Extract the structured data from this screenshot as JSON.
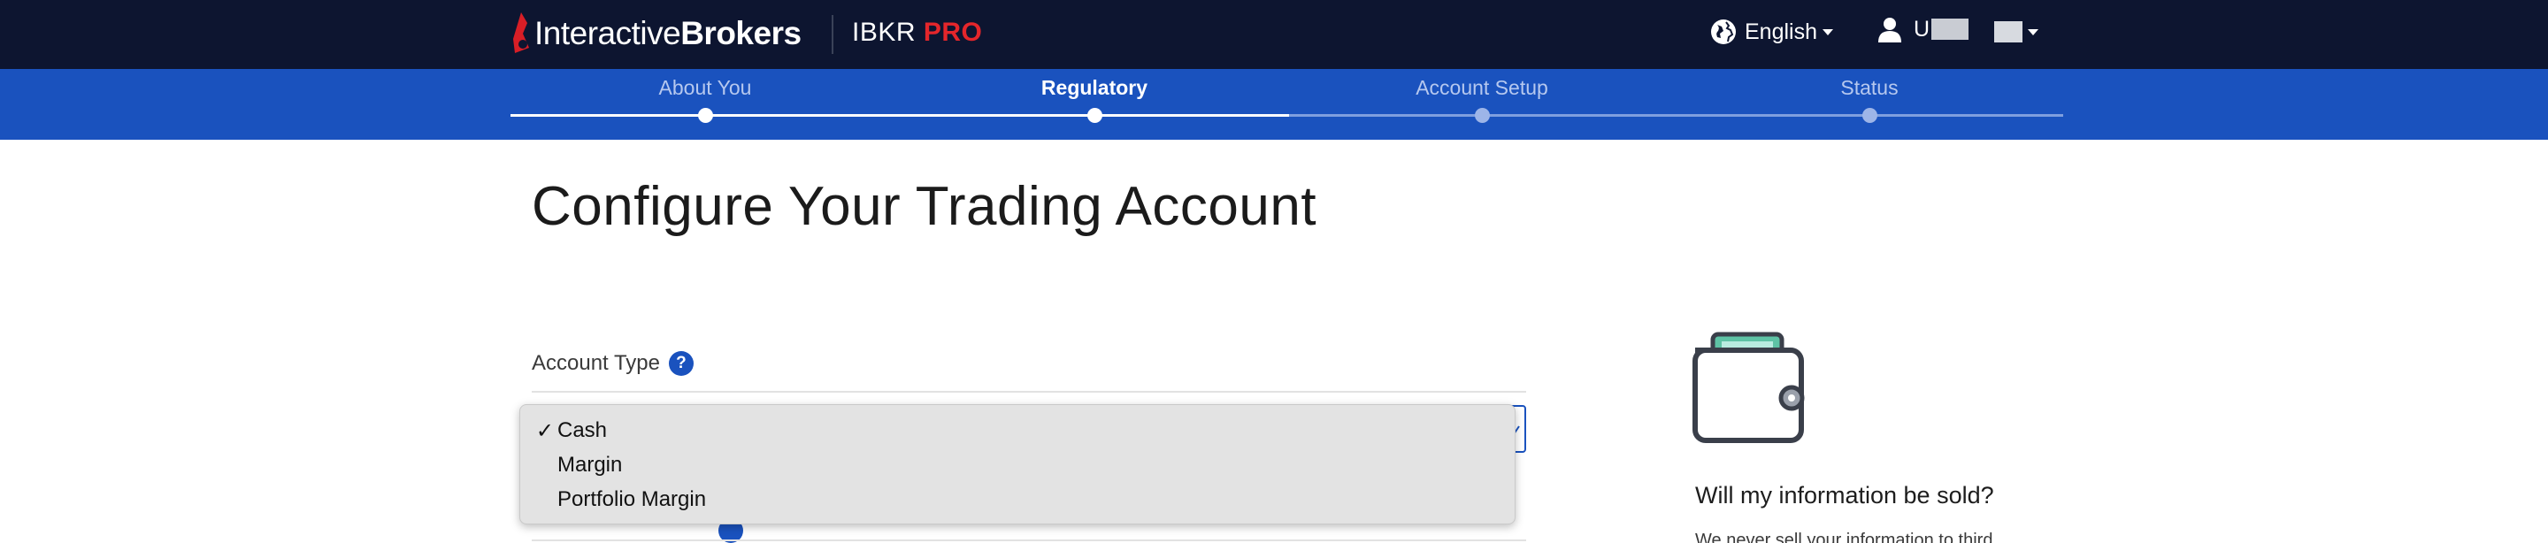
{
  "header": {
    "brand_regular": "Interactive",
    "brand_bold": "Brokers",
    "product_name": "IBKR",
    "product_tier": "PRO",
    "language_label": "English",
    "user_initial": "U",
    "icons": {
      "logo": "ib-logo-icon",
      "language": "globe-icon",
      "user": "user-icon",
      "flag": "flag-icon"
    }
  },
  "steps": [
    {
      "label": "About You",
      "state": "complete"
    },
    {
      "label": "Regulatory",
      "state": "active"
    },
    {
      "label": "Account Setup",
      "state": "pending"
    },
    {
      "label": "Status",
      "state": "pending"
    }
  ],
  "main": {
    "title": "Configure Your Trading Account",
    "account_type": {
      "label": "Account Type",
      "help_symbol": "?",
      "options": [
        {
          "label": "Cash",
          "selected": true,
          "mark": "✓"
        },
        {
          "label": "Margin",
          "selected": false,
          "mark": ""
        },
        {
          "label": "Portfolio Margin",
          "selected": false,
          "mark": ""
        }
      ]
    }
  },
  "side": {
    "icon": "wallet-icon",
    "heading": "Will my information be sold?",
    "text": "We never sell your information to third"
  },
  "colors": {
    "topbar": "#0d1530",
    "accent": "#1a52be",
    "brand_red": "#e4262b"
  }
}
